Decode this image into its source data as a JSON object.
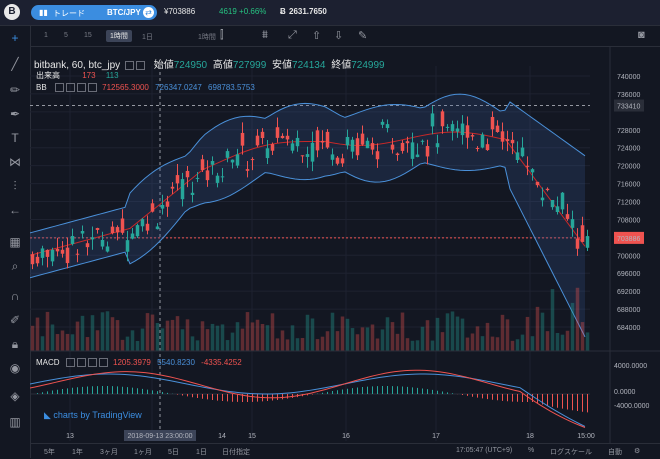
{
  "header": {
    "logo": "B",
    "trade_label": "トレード",
    "pair": "BTC/JPY",
    "yen_value": "¥703886",
    "change": "4619 +0.66%",
    "btc_value": "2631.7650"
  },
  "timeframes": [
    "1",
    "5",
    "15",
    "1時間",
    "1日",
    "1時間"
  ],
  "selected_timeframe": "1時間",
  "legend": {
    "symbol": "bitbank, 60, btc_jpy",
    "open_label": "始値",
    "open": "724950",
    "high_label": "高値",
    "high": "727999",
    "low_label": "安値",
    "low": "724134",
    "close_label": "終値",
    "close": "724999",
    "volume_label": "出来高",
    "volume_a": "173",
    "volume_b": "113",
    "bb_label": "BB",
    "bb_upper": "712565.3000",
    "bb_mid": "726347.0247",
    "bb_lower": "698783.5753",
    "macd_label": "MACD",
    "macd_a": "1205.3979",
    "macd_b": "5540.8230",
    "macd_c": "-4335.4252"
  },
  "price_axis": [
    "740000",
    "736000",
    "733410",
    "728000",
    "724000",
    "720000",
    "716000",
    "712000",
    "708000",
    "703886",
    "700000",
    "696000",
    "692000",
    "688000",
    "684000"
  ],
  "price_tag_current": "703886",
  "price_tag_line": "733410",
  "macd_axis": [
    "4000.0000",
    "0.0000",
    "-4000.0000"
  ],
  "time_axis": [
    "13",
    "2018-09-13 23:00:00",
    "14",
    "15",
    "16",
    "17",
    "18",
    "15:00"
  ],
  "watermark": "charts by TradingView",
  "bottom_bar": {
    "ranges": [
      "5年",
      "1年",
      "3ヶ月",
      "1ヶ月",
      "5日",
      "1日"
    ],
    "date_range": "日付指定",
    "clock": "17:05:47 (UTC+9)",
    "percent": "%",
    "log": "ログスケール",
    "auto": "自動"
  },
  "colors": {
    "up": "#26a69a",
    "down": "#ef5350",
    "band": "#4a90d9",
    "mid": "#c62828",
    "accent": "#3b8de0"
  }
}
